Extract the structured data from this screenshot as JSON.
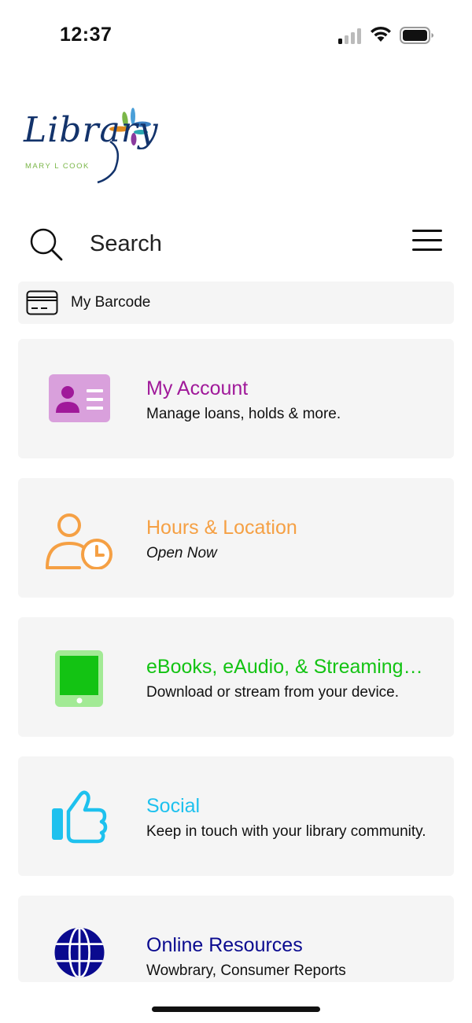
{
  "status_bar": {
    "time": "12:37"
  },
  "logo": {
    "wordmark": "Library",
    "subtitle": "MARY L COOK"
  },
  "search": {
    "placeholder": "Search"
  },
  "barcode": {
    "label": "My Barcode"
  },
  "cards": [
    {
      "title": "My Account",
      "subtitle": "Manage loans, holds & more.",
      "color": "#a0199a",
      "icon": "id-card-icon"
    },
    {
      "title": "Hours & Location",
      "subtitle": "Open Now",
      "color": "#f5a044",
      "icon": "person-clock-icon"
    },
    {
      "title": "eBooks, eAudio, & Streaming…",
      "subtitle": "Download or stream from your device.",
      "color": "#13c313",
      "icon": "tablet-icon"
    },
    {
      "title": "Social",
      "subtitle": "Keep in touch with your library community.",
      "color": "#1ec1ee",
      "icon": "thumbs-up-icon"
    },
    {
      "title": "Online Resources",
      "subtitle": "Wowbrary, Consumer Reports",
      "color": "#0a0a8f",
      "icon": "globe-icon"
    }
  ]
}
